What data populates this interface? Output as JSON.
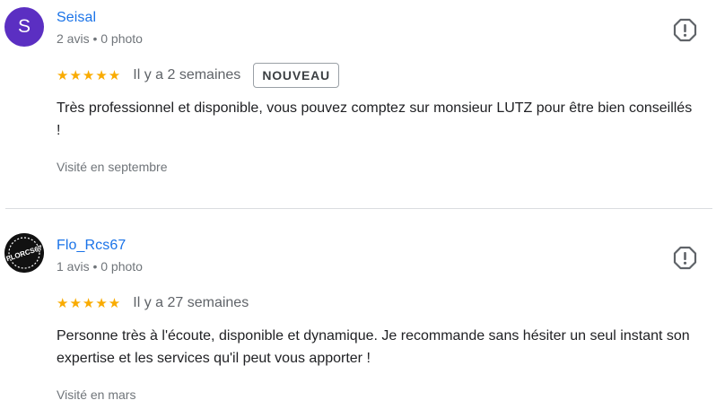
{
  "reviews": [
    {
      "reviewer_name": "Seisal",
      "avatar_letter": "S",
      "avatar_color": "#5b2fc2",
      "meta": "2 avis • 0 photo",
      "stars": "★★★★★",
      "rating": 5,
      "date": "Il y a 2 semaines",
      "badge": "NOUVEAU",
      "text": "Très professionnel et disponible, vous pouvez comptez sur monsieur LUTZ pour être bien conseillés !",
      "visited": "Visité en septembre",
      "flag_icon": "report-flag-icon"
    },
    {
      "reviewer_name": "Flo_Rcs67",
      "avatar_logo_text": "FLORCS67",
      "meta": "1 avis • 0 photo",
      "stars": "★★★★★",
      "rating": 5,
      "date": "Il y a 27 semaines",
      "text": "Personne très à l'écoute, disponible et dynamique. Je recommande sans hésiter un seul instant son expertise et les services qu'il peut vous apporter !",
      "visited": "Visité en mars",
      "flag_icon": "report-flag-icon"
    }
  ]
}
